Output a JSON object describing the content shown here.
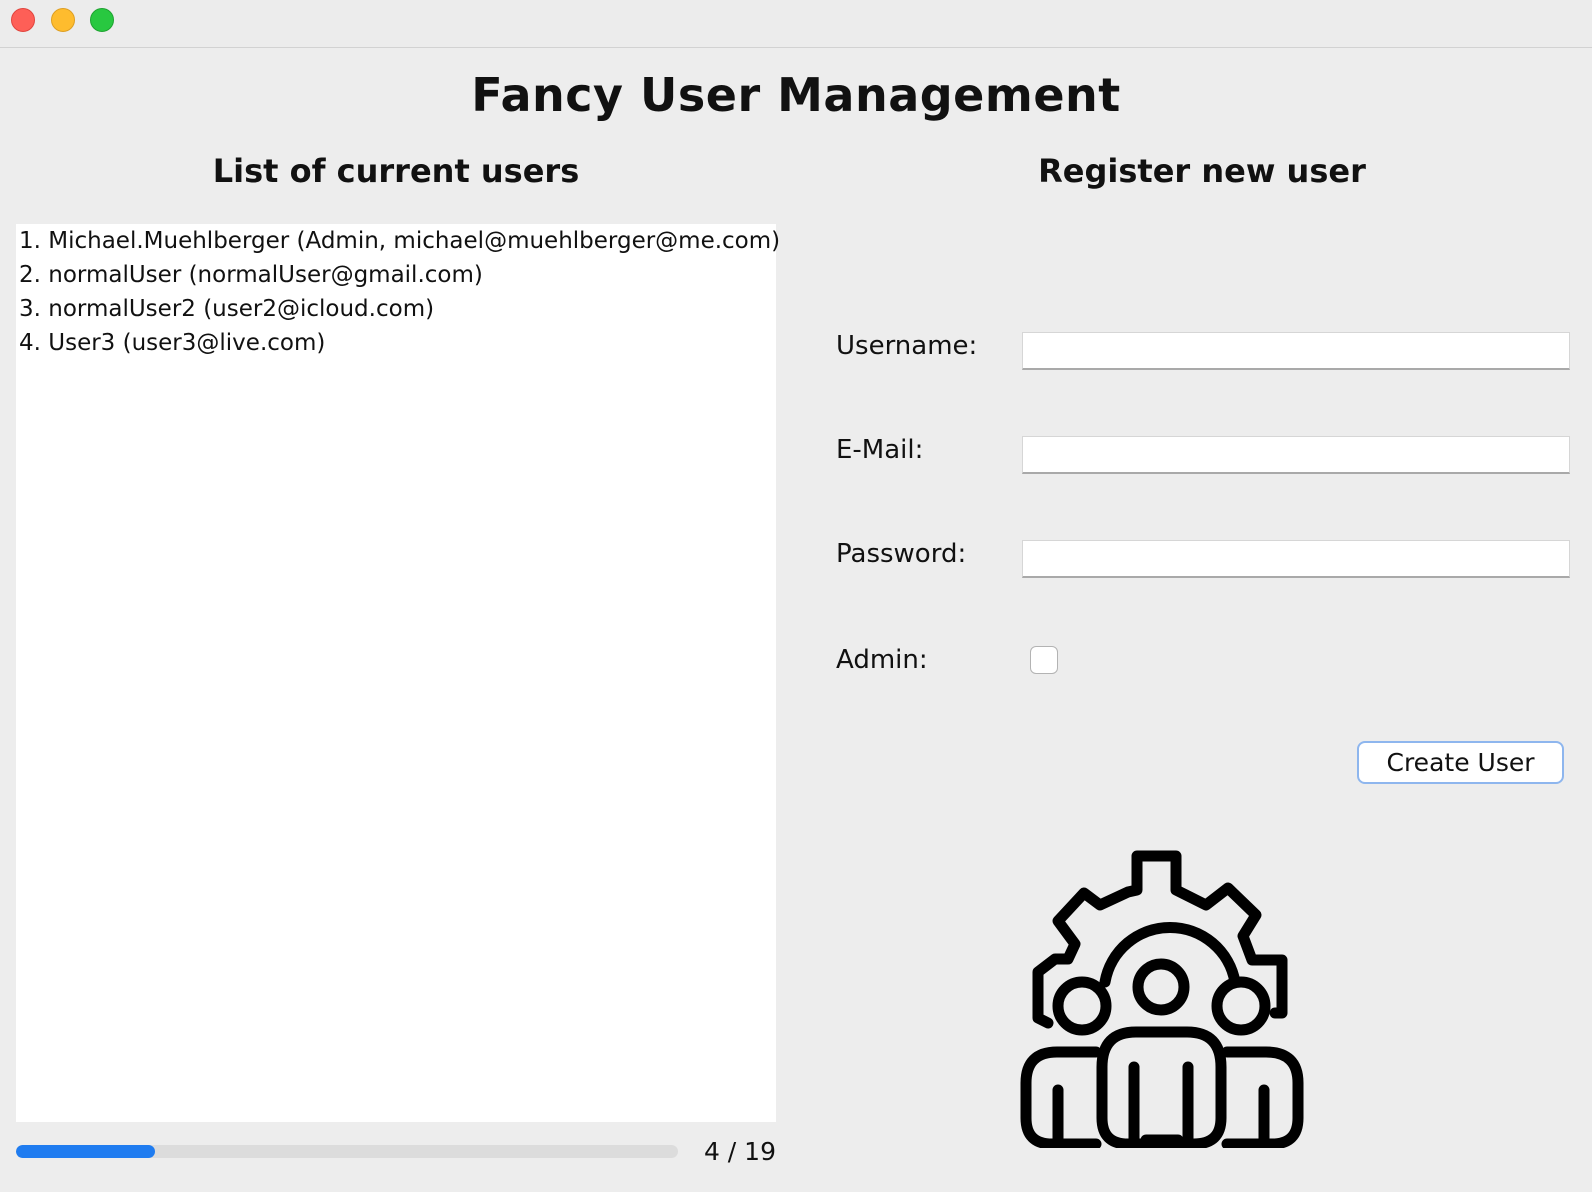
{
  "window": {
    "controls": [
      "close",
      "minimize",
      "maximize"
    ]
  },
  "app": {
    "title": "Fancy User Management"
  },
  "user_list": {
    "title": "List of current users",
    "items": [
      "1. Michael.Muehlberger (Admin, michael@muehlberger@me.com)",
      "2. normalUser (normalUser@gmail.com)",
      "3. normalUser2 (user2@icloud.com)",
      "4. User3 (user3@live.com)"
    ],
    "progress": {
      "current": 4,
      "total": 19,
      "fraction": 0.21,
      "text": "4 / 19",
      "color": "#1f7cf0"
    }
  },
  "register": {
    "title": "Register new user",
    "username_label": "Username:",
    "username_value": "",
    "email_label": "E-Mail:",
    "email_value": "",
    "password_label": "Password:",
    "password_value": "",
    "admin_label": "Admin:",
    "admin_checked": false,
    "create_button_label": "Create User",
    "icon": "team-gear-icon"
  }
}
